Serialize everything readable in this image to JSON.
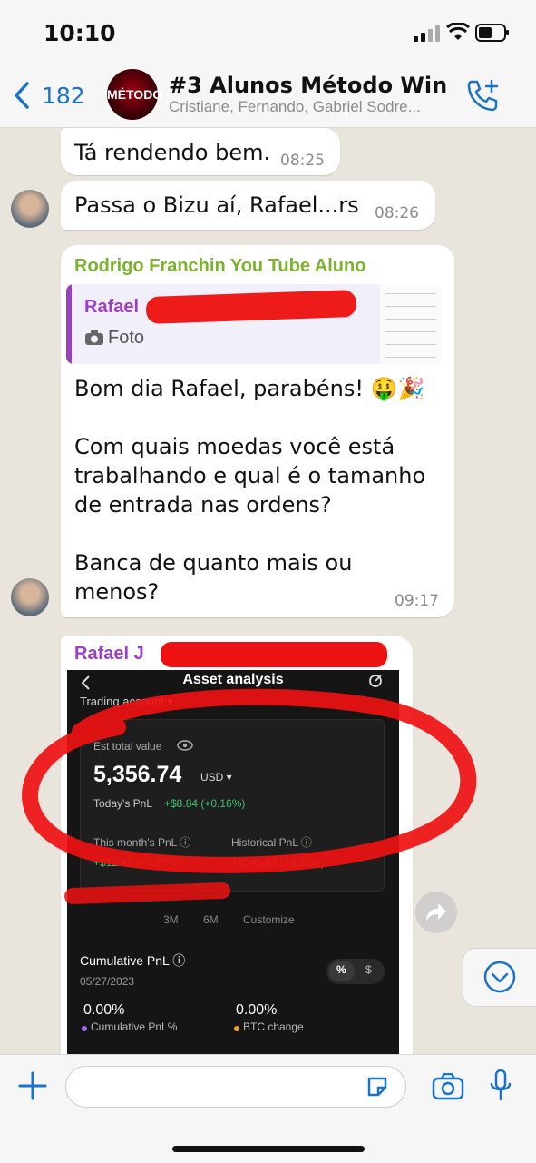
{
  "status_bar": {
    "time": "10:10"
  },
  "header": {
    "back_count": "182",
    "group_avatar_text": "MÉTODO WIN",
    "title": "#3 Alunos Método Win",
    "members": "Cristiane, Fernando, Gabriel Sodre..."
  },
  "messages": [
    {
      "text": "Tá rendendo bem.",
      "time": "08:25"
    },
    {
      "text": "Passa o Bizu aí, Rafael...rs",
      "time": "08:26"
    },
    {
      "sender": "Rodrigo Franchin You Tube Aluno",
      "reply": {
        "name": "Rafael",
        "media": "Foto"
      },
      "paragraphs": [
        "Bom dia Rafael, parabéns! 🤑🎉",
        "Com quais moedas você está trabalhando e qual é o tamanho de entrada nas ordens?",
        "Banca de quanto mais ou menos?"
      ],
      "time": "09:17"
    },
    {
      "sender": "Rafael J"
    }
  ],
  "screenshot": {
    "title": "Asset analysis",
    "account": "Trading account ▾",
    "est_label": "Est total value",
    "total_value": "5,356.74",
    "currency": "USD ▾",
    "todays_pnl_label": "Today's PnL",
    "todays_pnl_value": "+$8.84 (+0.16%)",
    "month_label": "This month's PnL ⓘ",
    "month_value": "+$12.47 (+0.23%)",
    "hist_label": "Historical PnL ⓘ",
    "hist_value": "+$345.80 (+6.91%)",
    "tabs": [
      "3M",
      "6M",
      "Customize"
    ],
    "cumulative_label": "Cumulative PnL ⓘ",
    "date": "05/27/2023",
    "toggle_pct": "%",
    "toggle_usd": "$",
    "cum_pct_value": "0.00%",
    "cum_pct_label": "Cumulative PnL%",
    "btc_value": "0.00%",
    "btc_label": "BTC change"
  },
  "colors": {
    "accent": "#1a73c9",
    "sender_green": "#7bb32e",
    "sender_purple": "#9c3fc7",
    "gain": "#3ec46d",
    "annotation": "#ee1111"
  }
}
